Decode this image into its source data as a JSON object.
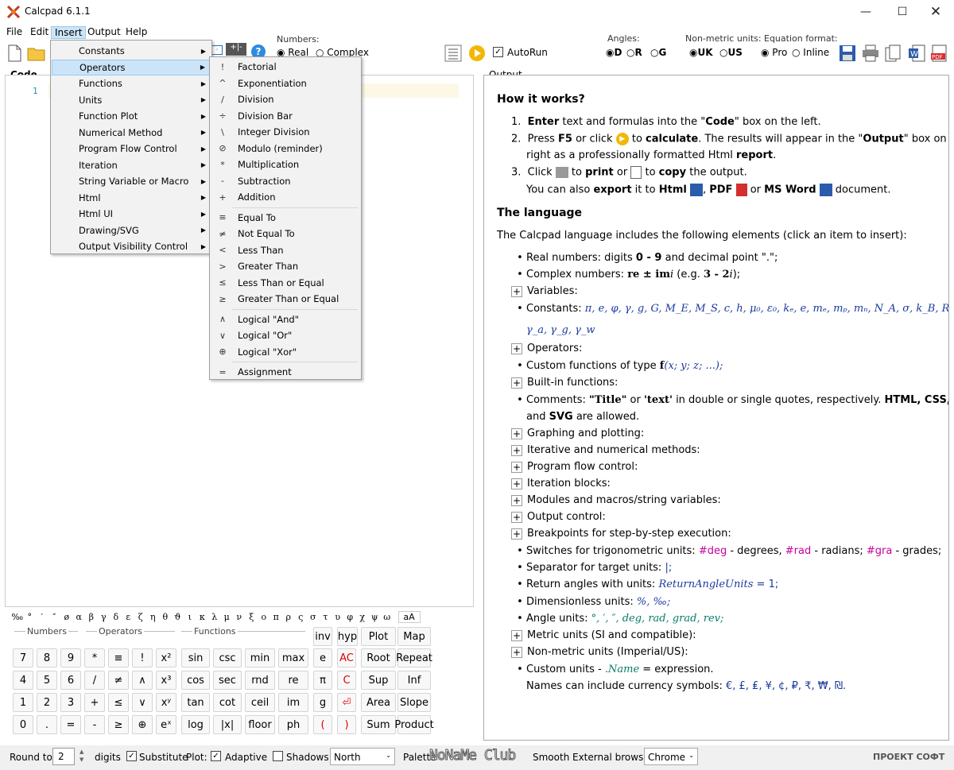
{
  "app": {
    "title": "Calcpad 6.1.1"
  },
  "menu": [
    "File",
    "Edit",
    "Insert",
    "Output",
    "Help"
  ],
  "toolbar": {
    "numbers_label": "Numbers:",
    "real": "Real",
    "complex": "Complex",
    "autorun": "AutoRun",
    "angles_label": "Angles:",
    "angle_d": "D",
    "angle_r": "R",
    "angle_g": "G",
    "nonmetric_label": "Non-metric units:",
    "uk": "UK",
    "us": "US",
    "eqformat_label": "Equation format:",
    "pro": "Pro",
    "inline": "Inline"
  },
  "code": {
    "label": "Code",
    "line": "1"
  },
  "output": {
    "label": "Output"
  },
  "insert_menu": [
    "Constants",
    "Operators",
    "Functions",
    "Units",
    "Function Plot",
    "Numerical Method",
    "Program Flow Control",
    "Iteration",
    "String Variable or Macro",
    "Html",
    "Html UI",
    "Drawing/SVG",
    "Output Visibility Control"
  ],
  "operators": [
    {
      "sym": "!",
      "label": "Factorial"
    },
    {
      "sym": "^",
      "label": "Exponentiation"
    },
    {
      "sym": "/",
      "label": "Division"
    },
    {
      "sym": "÷",
      "label": "Division Bar"
    },
    {
      "sym": "\\",
      "label": "Integer Division"
    },
    {
      "sym": "⊘",
      "label": "Modulo (reminder)"
    },
    {
      "sym": "*",
      "label": "Multiplication"
    },
    {
      "sym": "-",
      "label": "Subtraction"
    },
    {
      "sym": "+",
      "label": "Addition"
    },
    {
      "sym": "≡",
      "label": "Equal To"
    },
    {
      "sym": "≠",
      "label": "Not Equal To"
    },
    {
      "sym": "<",
      "label": "Less Than"
    },
    {
      "sym": ">",
      "label": "Greater Than"
    },
    {
      "sym": "≤",
      "label": "Less Than or Equal"
    },
    {
      "sym": "≥",
      "label": "Greater Than or Equal"
    },
    {
      "sym": "∧",
      "label": "Logical \"And\""
    },
    {
      "sym": "∨",
      "label": "Logical \"Or\""
    },
    {
      "sym": "⊕",
      "label": "Logical \"Xor\""
    },
    {
      "sym": "=",
      "label": "Assignment"
    }
  ],
  "greek": [
    "‰",
    "°",
    "′",
    "″",
    "ø",
    "α",
    "β",
    "γ",
    "δ",
    "ε",
    "ζ",
    "η",
    "θ",
    "ϑ",
    "ι",
    "κ",
    "λ",
    "μ",
    "ν",
    "ξ",
    "ο",
    "π",
    "ρ",
    "ς",
    "σ",
    "τ",
    "υ",
    "φ",
    "χ",
    "ψ",
    "ω",
    "aA"
  ],
  "keypad": {
    "groups": [
      "Numbers",
      "Operators",
      "Functions"
    ],
    "row1": [
      "7",
      "8",
      "9",
      "*",
      "≡",
      "!",
      "x²",
      "sin",
      "csc",
      "min",
      "max",
      "e",
      "AC",
      "Root",
      "Repeat"
    ],
    "row2": [
      "4",
      "5",
      "6",
      "/",
      "≠",
      "∧",
      "x³",
      "cos",
      "sec",
      "rnd",
      "re",
      "π",
      "C",
      "Sup",
      "Inf"
    ],
    "row3": [
      "1",
      "2",
      "3",
      "+",
      "≤",
      "∨",
      "xʸ",
      "tan",
      "cot",
      "ceil",
      "im",
      "g",
      "⏎",
      "Area",
      "Slope"
    ],
    "row4": [
      "0",
      ".",
      "=",
      "-",
      "≥",
      "⊕",
      "eˣ",
      "log",
      "|x|",
      "floor",
      "ph",
      "(",
      ")",
      "Sum",
      "Product"
    ],
    "top": [
      "inv",
      "hyp",
      "Plot",
      "Map"
    ]
  },
  "status": {
    "round_to": "Round to",
    "digits_val": "2",
    "digits": "digits",
    "substitute": "Substitute",
    "plot": "Plot:",
    "adaptive": "Adaptive",
    "shadows": "Shadows:",
    "shadows_val": "North",
    "palette": "Palette",
    "smooth": "Smooth",
    "ext_browser": "External browser:",
    "browser_val": "Chrome",
    "brand": "ПРОЕКТ СОФТ",
    "watermark": "NoNaMe Club"
  },
  "help": {
    "h1": "How it works?",
    "s1a": "Enter",
    "s1b": " text and formulas into the \"",
    "s1c": "Code",
    "s1d": "\" box on the left.",
    "s2a": "Press ",
    "s2b": "F5",
    "s2c": " or click ",
    "s2d": " to ",
    "s2e": "calculate",
    "s2f": ". The results will appear in the \"",
    "s2g": "Output",
    "s2h": "\" box on the",
    "s2i": "right as a professionally formatted Html ",
    "s2j": "report",
    "s3a": "Click ",
    "s3b": "print",
    "s3c": " or ",
    "s3d": "copy",
    "s3e": " the output.",
    "s3f": "You can also ",
    "s3g": "export",
    "s3h": " it to ",
    "s3i": "Html",
    "s3j": "PDF",
    "s3k": "MS Word",
    "s3l": " document.",
    "h2": "The language",
    "intro": "The Calcpad language includes the following elements (click an item to insert):",
    "real": "Real numbers: digits ",
    "real2": "0 - 9",
    "real3": " and decimal point \".\";",
    "complex": "Complex numbers: ",
    "complex2": "re ± im",
    "complex3": "i",
    "complex4": " (e.g. ",
    "complex5": "3 - 2",
    "complex6": "i",
    "complex7": ");",
    "variables": "Variables:",
    "constants": "Constants: ",
    "constants_list": "π, e, φ, γ, g, G, M_E, M_S, c, h, μ₀, ε₀, kₑ, e, mₑ, mₚ, mₙ, N_A, σ, k_B, R, F, γ_c, γ_s,",
    "constants_list2": "γ_a, γ_g, γ_w",
    "operators": "Operators:",
    "custom": "Custom functions of type ",
    "custom2": "f",
    "custom3": "(x; y; z; ...);",
    "builtin": "Built-in functions:",
    "comments": "Comments: ",
    "comments2": "\"Title\"",
    "comments3": " or ",
    "comments4": "'text'",
    "comments5": " in double or single quotes, respectively. ",
    "comments6": "HTML, CSS, JS",
    "comments7": "and ",
    "comments8": "SVG",
    "comments9": " are allowed.",
    "graphing": "Graphing and plotting:",
    "iterative": "Iterative and numerical methods:",
    "flow": "Program flow control:",
    "iteration": "Iteration blocks:",
    "modules": "Modules and macros/string variables:",
    "outctl": "Output control:",
    "breakpoints": "Breakpoints for step-by-step execution:",
    "switches": "Switches for trigonometric units: ",
    "sw1": "#deg",
    "sw2": " - degrees, ",
    "sw3": "#rad",
    "sw4": " - radians; ",
    "sw5": "#gra",
    "sw6": " - grades;",
    "separator": "Separator for target units: ",
    "sep2": "|;",
    "return": "Return angles with units: ",
    "ret2": "ReturnAngleUnits",
    "ret3": " = 1;",
    "dimless": "Dimensionless units: ",
    "dim2": "%, ‰;",
    "angle": "Angle units: ",
    "angle2": "°, ′, ″, deg, rad, grad, rev;",
    "metric": "Metric units (SI and compatible):",
    "nonmetric": "Non-metric units (Imperial/US):",
    "customunits": "Custom units - ",
    "cu2": ".Name",
    "cu3": " = expression.",
    "currency": "Names can include currency symbols: ",
    "cur2": "€, £, ₤, ¥, ¢, ₽, ₹, ₩, ₪."
  }
}
